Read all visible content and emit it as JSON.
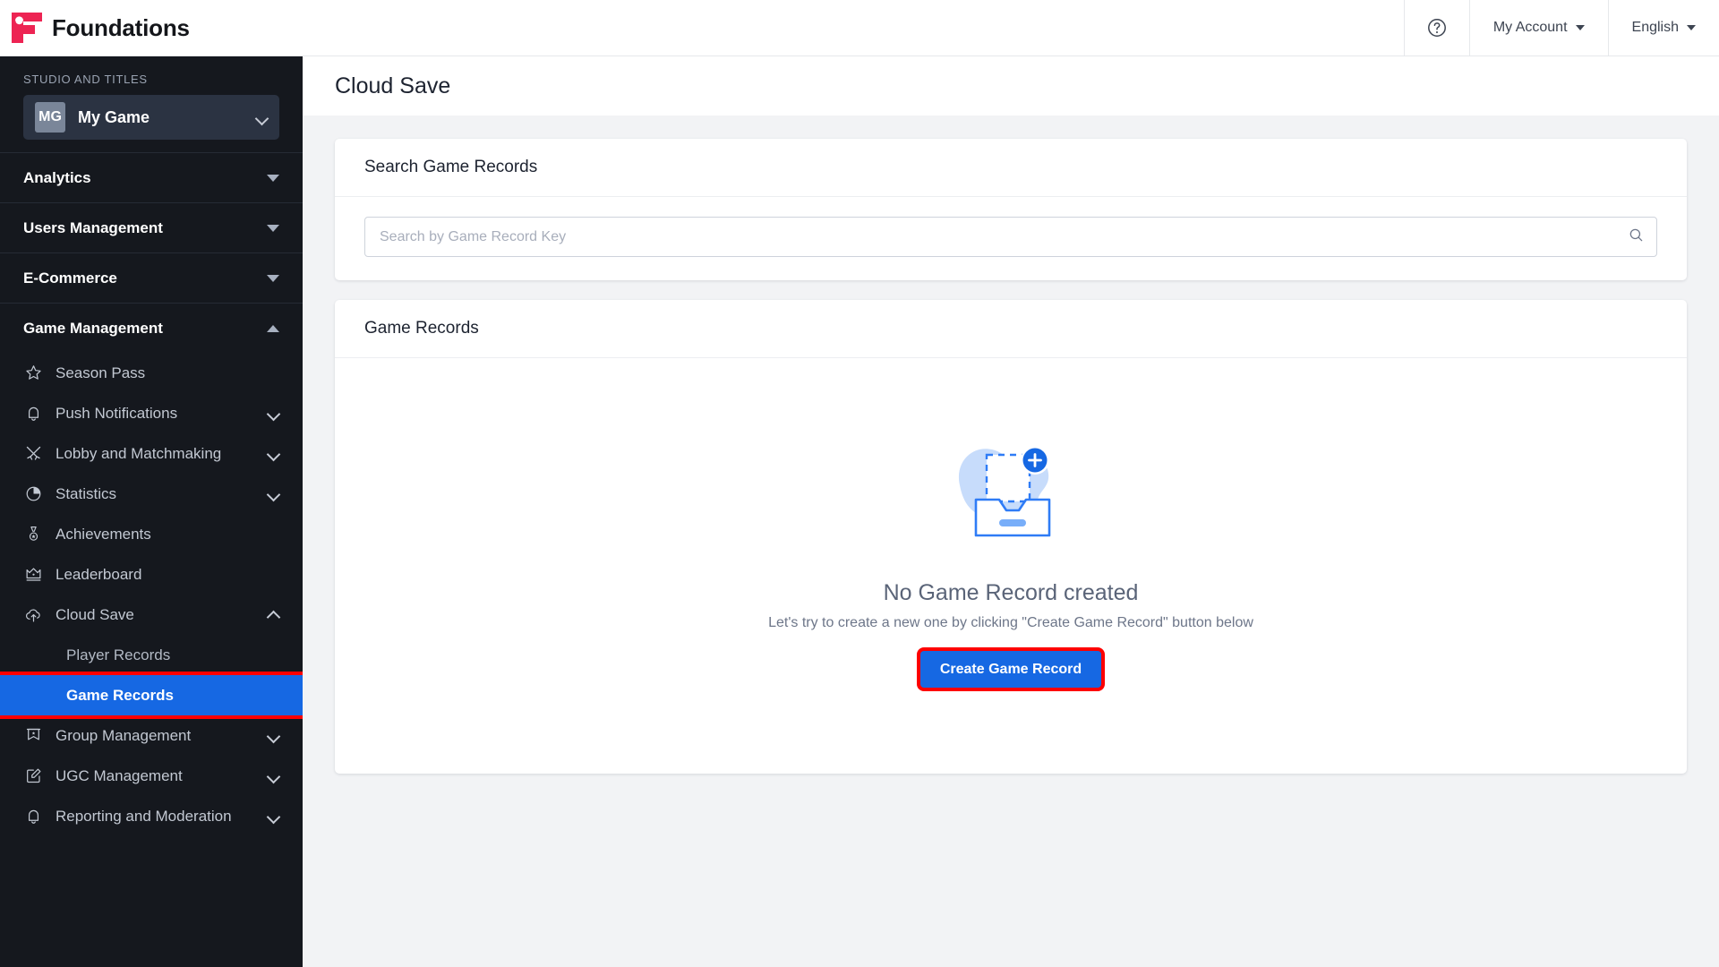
{
  "topbar": {
    "brand_name": "Foundations",
    "help_icon": "help-circle-icon",
    "account_label": "My Account",
    "language_label": "English"
  },
  "sidebar": {
    "studio_label": "STUDIO AND TITLES",
    "studio_initials": "MG",
    "studio_name": "My Game",
    "sections": [
      {
        "label": "Analytics",
        "expanded": false
      },
      {
        "label": "Users Management",
        "expanded": false
      },
      {
        "label": "E-Commerce",
        "expanded": false
      },
      {
        "label": "Game Management",
        "expanded": true
      }
    ],
    "game_management_items": [
      {
        "label": "Season Pass",
        "icon": "star-icon",
        "chevron": false
      },
      {
        "label": "Push Notifications",
        "icon": "bell-icon",
        "chevron": true
      },
      {
        "label": "Lobby and Matchmaking",
        "icon": "crossed-swords-icon",
        "chevron": true
      },
      {
        "label": "Statistics",
        "icon": "pie-chart-icon",
        "chevron": true
      },
      {
        "label": "Achievements",
        "icon": "medal-icon",
        "chevron": false
      },
      {
        "label": "Leaderboard",
        "icon": "crown-icon",
        "chevron": false
      },
      {
        "label": "Cloud Save",
        "icon": "cloud-upload-icon",
        "chevron": true,
        "expanded": true
      }
    ],
    "cloud_save_children": [
      {
        "label": "Player Records",
        "active": false
      },
      {
        "label": "Game Records",
        "active": true
      }
    ],
    "bottom_items": [
      {
        "label": "Group Management",
        "icon": "flag-banner-icon",
        "chevron": true
      },
      {
        "label": "UGC Management",
        "icon": "edit-square-icon",
        "chevron": true
      },
      {
        "label": "Reporting and Moderation",
        "icon": "bell-icon",
        "chevron": true
      }
    ]
  },
  "main": {
    "page_title": "Cloud Save",
    "search_card": {
      "title": "Search Game Records",
      "placeholder": "Search by Game Record Key",
      "value": "",
      "search_icon": "search-icon"
    },
    "records_card": {
      "title": "Game Records",
      "empty_illustration": "empty-inbox-add-icon",
      "empty_title": "No Game Record created",
      "empty_subtitle": "Let's try to create a new one by clicking \"Create Game Record\" button below",
      "create_button": "Create Game Record"
    }
  },
  "colors": {
    "brand_red": "#ED2453",
    "accent_blue": "#1668E3",
    "sidebar_bg": "#15181E",
    "highlight_red": "#FE0000",
    "page_bg": "#F2F3F5"
  }
}
